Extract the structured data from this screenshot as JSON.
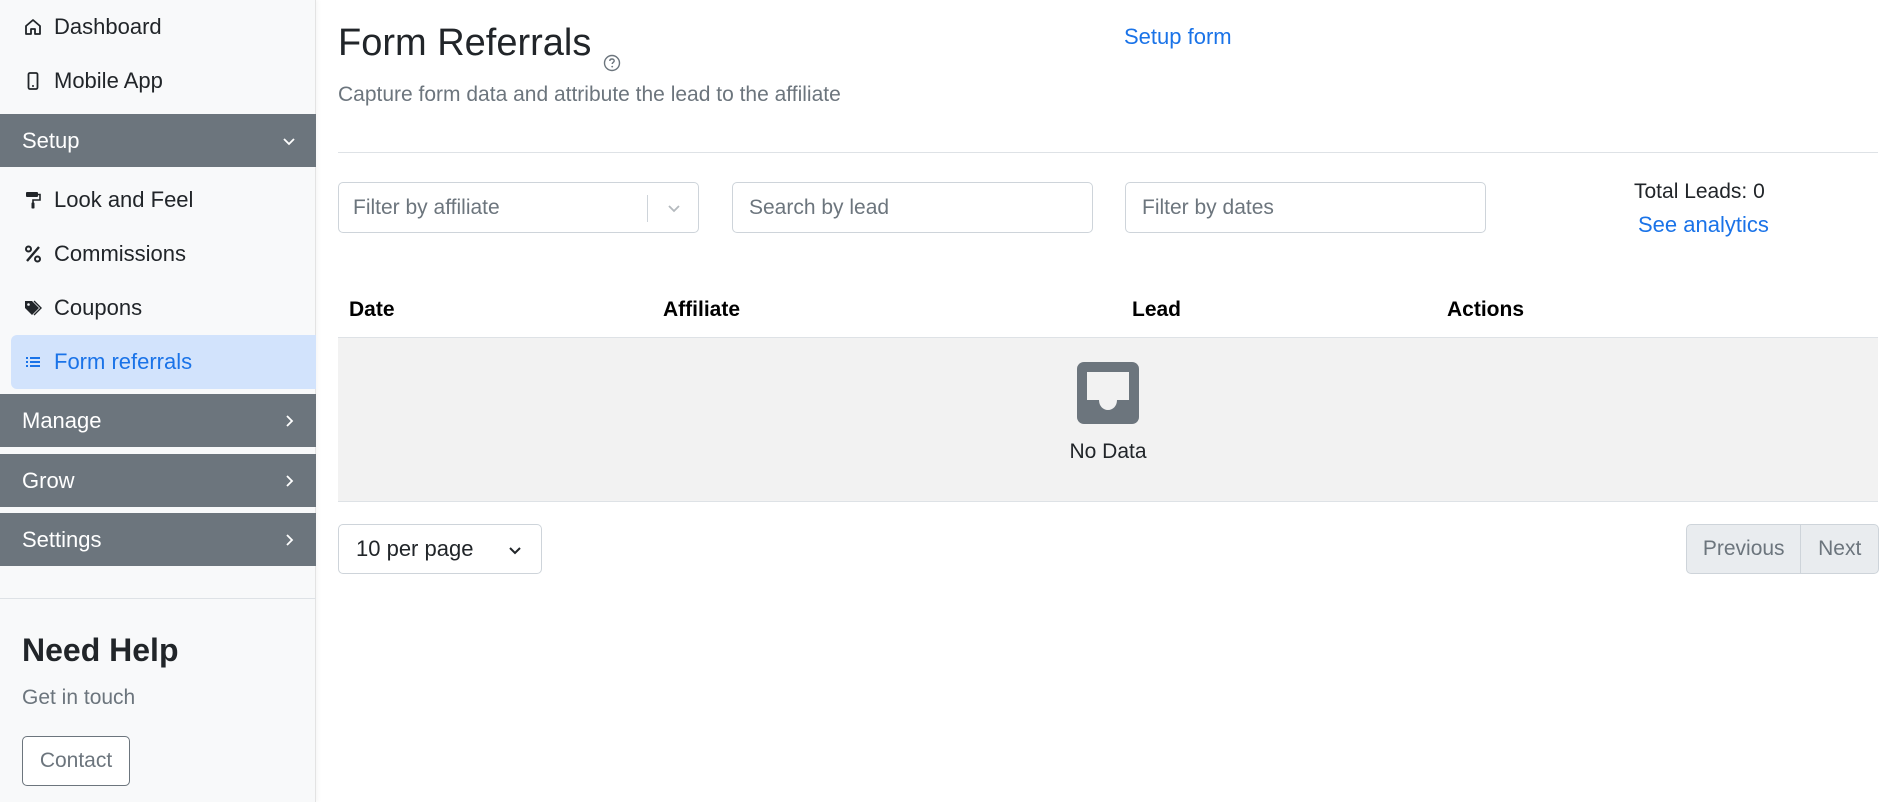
{
  "sidebar": {
    "items_top": [
      {
        "label": "Dashboard",
        "icon": "home-icon"
      },
      {
        "label": "Mobile App",
        "icon": "mobile-icon"
      }
    ],
    "setup_section": {
      "label": "Setup",
      "icon": "chevron-down-icon"
    },
    "setup_items": [
      {
        "label": "Look and Feel",
        "icon": "paint-roller-icon"
      },
      {
        "label": "Commissions",
        "icon": "percent-icon"
      },
      {
        "label": "Coupons",
        "icon": "tags-icon"
      },
      {
        "label": "Form referrals",
        "icon": "list-icon",
        "active": true
      }
    ],
    "sections": [
      {
        "label": "Manage",
        "icon": "chevron-right-icon"
      },
      {
        "label": "Grow",
        "icon": "chevron-right-icon"
      },
      {
        "label": "Settings",
        "icon": "chevron-right-icon"
      }
    ],
    "help": {
      "title": "Need Help",
      "subtitle": "Get in touch",
      "contact_label": "Contact"
    }
  },
  "header": {
    "title": "Form Referrals",
    "setup_link": "Setup form",
    "subtitle": "Capture form data and attribute the lead to the affiliate"
  },
  "filters": {
    "affiliate_placeholder": "Filter by affiliate",
    "lead_placeholder": "Search by lead",
    "dates_placeholder": "Filter by dates"
  },
  "stats": {
    "total_leads": "Total Leads: 0",
    "analytics_link": "See analytics"
  },
  "table": {
    "columns": [
      "Date",
      "Affiliate",
      "Lead",
      "Actions"
    ],
    "empty_text": "No Data"
  },
  "pagination": {
    "per_page": "10 per page",
    "previous": "Previous",
    "next": "Next"
  },
  "colors": {
    "accent": "#1a73e8",
    "sidebar_section": "#6c757d",
    "active_bg": "#d2e3fc"
  }
}
